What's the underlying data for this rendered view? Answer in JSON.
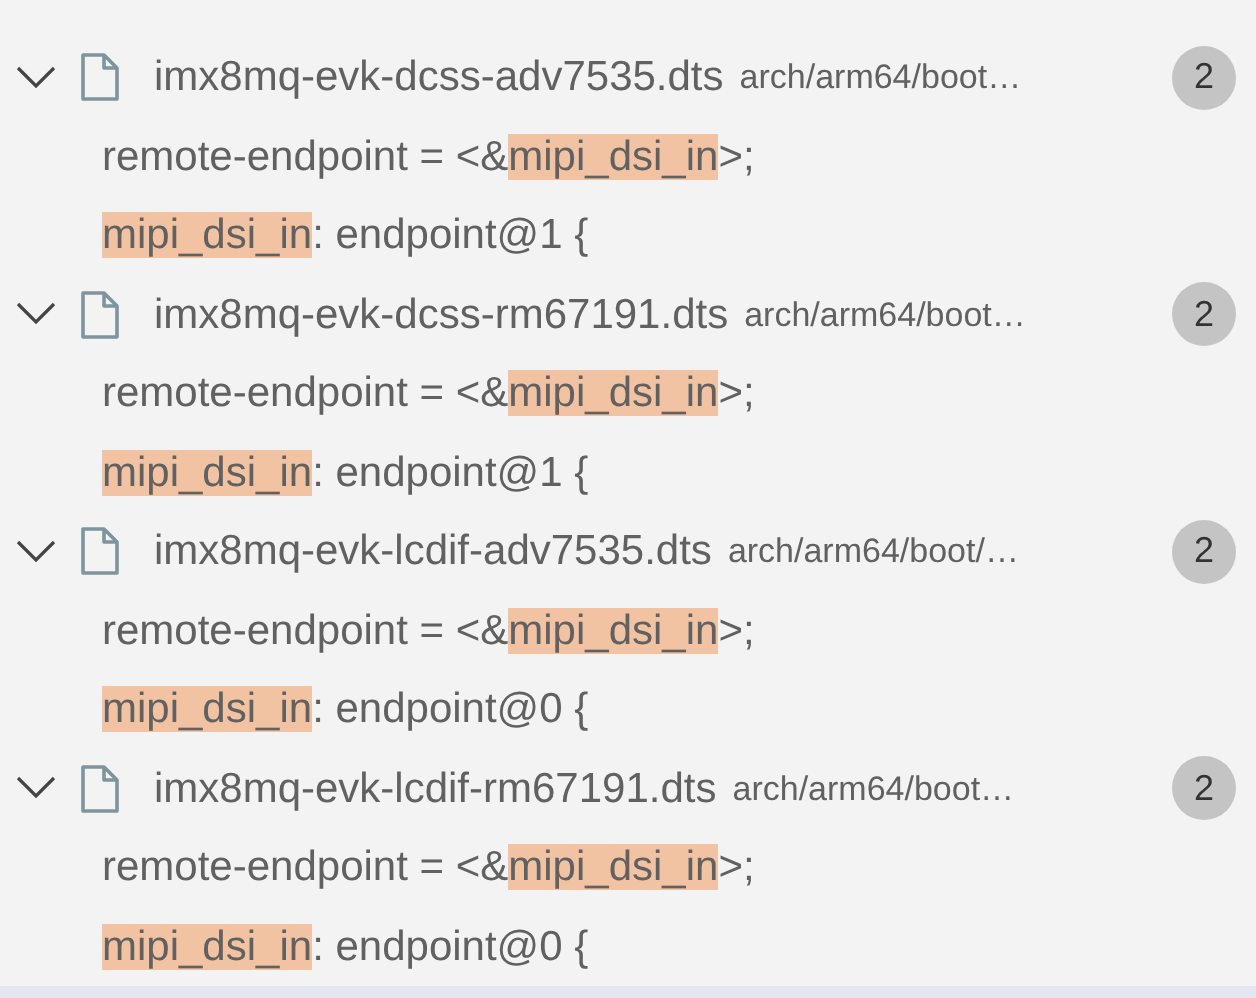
{
  "results": [
    {
      "expanded": true,
      "file": "imx8mq-evk-dcss-adv7535.dts",
      "path": "arch/arm64/boot…",
      "count": "2",
      "matches": [
        {
          "before": "remote-endpoint = <&",
          "match": "mipi_dsi_in",
          "after": ">;"
        },
        {
          "match": "mipi_dsi_in",
          "after": ": endpoint@1 {"
        }
      ]
    },
    {
      "expanded": true,
      "file": "imx8mq-evk-dcss-rm67191.dts",
      "path": "arch/arm64/boot…",
      "count": "2",
      "matches": [
        {
          "before": "remote-endpoint = <&",
          "match": "mipi_dsi_in",
          "after": ">;"
        },
        {
          "match": "mipi_dsi_in",
          "after": ": endpoint@1 {"
        }
      ]
    },
    {
      "expanded": true,
      "file": "imx8mq-evk-lcdif-adv7535.dts",
      "path": "arch/arm64/boot/…",
      "count": "2",
      "matches": [
        {
          "before": "remote-endpoint = <&",
          "match": "mipi_dsi_in",
          "after": ">;"
        },
        {
          "match": "mipi_dsi_in",
          "after": ": endpoint@0 {"
        }
      ]
    },
    {
      "expanded": true,
      "file": "imx8mq-evk-lcdif-rm67191.dts",
      "path": "arch/arm64/boot…",
      "count": "2",
      "matches": [
        {
          "before": "remote-endpoint = <&",
          "match": "mipi_dsi_in",
          "after": ">;"
        },
        {
          "match": "mipi_dsi_in",
          "after": ": endpoint@0 {"
        }
      ]
    }
  ]
}
